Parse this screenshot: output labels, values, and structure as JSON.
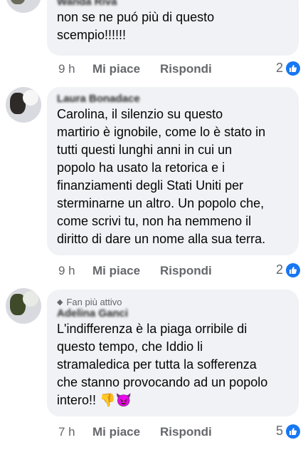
{
  "comments": [
    {
      "author": "Wanda Riva",
      "text": "non se ne puó più di questo\nscempio!!!!!!",
      "time": "9 h",
      "like_label": "Mi piace",
      "reply_label": "Rispondi",
      "reactions": "2"
    },
    {
      "author": "Laura Bonadace",
      "text": "Carolina, il silenzio su questo\nmartirio è ignobile, come lo è stato in\ntutti questi lunghi anni in cui un\npopolo ha usato la retorica e i\nfinanziamenti degli Stati Uniti per\nsterminarne un altro. Un popolo che,\ncome scrivi tu, non ha nemmeno il\ndiritto di dare un nome alla sua terra.",
      "time": "9 h",
      "like_label": "Mi piace",
      "reply_label": "Rispondi",
      "reactions": "2"
    },
    {
      "badge": "Fan più attivo",
      "author": "Adelina Ganci",
      "text": "L'indifferenza è la piaga orribile di\nquesto tempo, che Iddio li\nstramaledica per tutta la sofferenza\nche stanno provocando ad un popolo\nintero!! ",
      "emojis": "👎😈",
      "time": "7 h",
      "like_label": "Mi piace",
      "reply_label": "Rispondi",
      "reactions": "5"
    }
  ],
  "colors": {
    "bubble": "#f0f2f5",
    "muted": "#65676b",
    "like_blue": "#1877f2"
  }
}
